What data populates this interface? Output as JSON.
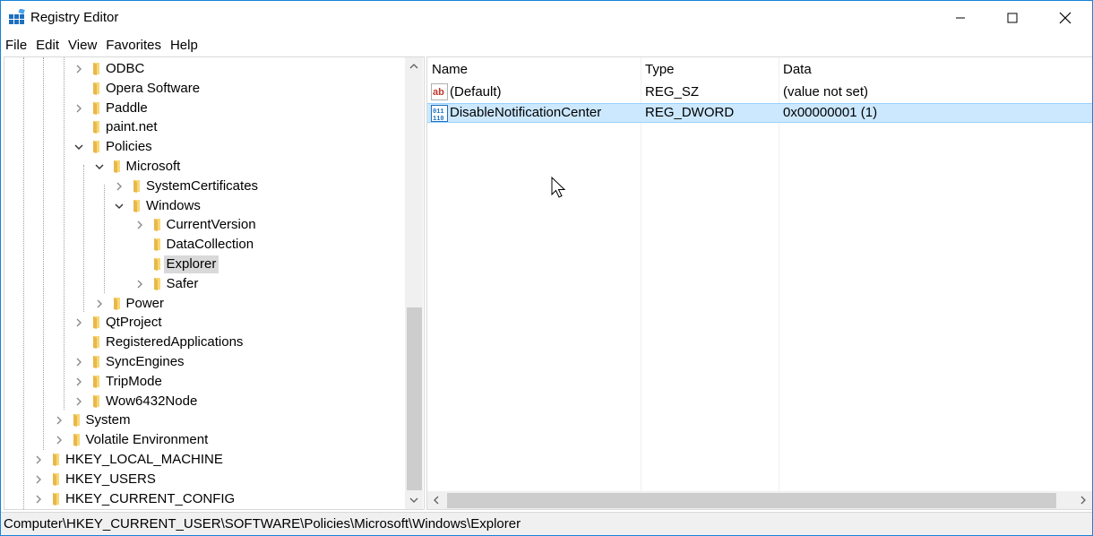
{
  "window": {
    "title": "Registry Editor"
  },
  "menu": [
    "File",
    "Edit",
    "View",
    "Favorites",
    "Help"
  ],
  "tree": [
    {
      "label": "ODBC",
      "depth": 3,
      "expander": "collapsed",
      "selected": false
    },
    {
      "label": "Opera Software",
      "depth": 3,
      "expander": "none",
      "selected": false
    },
    {
      "label": "Paddle",
      "depth": 3,
      "expander": "collapsed",
      "selected": false
    },
    {
      "label": "paint.net",
      "depth": 3,
      "expander": "none",
      "selected": false
    },
    {
      "label": "Policies",
      "depth": 3,
      "expander": "expanded",
      "selected": false
    },
    {
      "label": "Microsoft",
      "depth": 4,
      "expander": "expanded",
      "selected": false
    },
    {
      "label": "SystemCertificates",
      "depth": 5,
      "expander": "collapsed",
      "selected": false
    },
    {
      "label": "Windows",
      "depth": 5,
      "expander": "expanded",
      "selected": false
    },
    {
      "label": "CurrentVersion",
      "depth": 6,
      "expander": "collapsed",
      "selected": false
    },
    {
      "label": "DataCollection",
      "depth": 6,
      "expander": "none",
      "selected": false
    },
    {
      "label": "Explorer",
      "depth": 6,
      "expander": "none",
      "selected": true
    },
    {
      "label": "Safer",
      "depth": 6,
      "expander": "collapsed",
      "selected": false
    },
    {
      "label": "Power",
      "depth": 4,
      "expander": "collapsed",
      "selected": false
    },
    {
      "label": "QtProject",
      "depth": 3,
      "expander": "collapsed",
      "selected": false
    },
    {
      "label": "RegisteredApplications",
      "depth": 3,
      "expander": "none",
      "selected": false
    },
    {
      "label": "SyncEngines",
      "depth": 3,
      "expander": "collapsed",
      "selected": false
    },
    {
      "label": "TripMode",
      "depth": 3,
      "expander": "collapsed",
      "selected": false
    },
    {
      "label": "Wow6432Node",
      "depth": 3,
      "expander": "collapsed",
      "selected": false
    },
    {
      "label": "System",
      "depth": 2,
      "expander": "collapsed",
      "selected": false
    },
    {
      "label": "Volatile Environment",
      "depth": 2,
      "expander": "collapsed",
      "selected": false
    },
    {
      "label": "HKEY_LOCAL_MACHINE",
      "depth": 1,
      "expander": "collapsed",
      "selected": false
    },
    {
      "label": "HKEY_USERS",
      "depth": 1,
      "expander": "collapsed",
      "selected": false
    },
    {
      "label": "HKEY_CURRENT_CONFIG",
      "depth": 1,
      "expander": "collapsed",
      "selected": false
    }
  ],
  "list": {
    "columns": [
      "Name",
      "Type",
      "Data"
    ],
    "rows": [
      {
        "icon": "string-value-icon",
        "name": "(Default)",
        "type": "REG_SZ",
        "data": "(value not set)",
        "selected": false
      },
      {
        "icon": "binary-value-icon",
        "name": "DisableNotificationCenter",
        "type": "REG_DWORD",
        "data": "0x00000001 (1)",
        "selected": true
      }
    ]
  },
  "status": {
    "path": "Computer\\HKEY_CURRENT_USER\\SOFTWARE\\Policies\\Microsoft\\Windows\\Explorer"
  },
  "colors": {
    "accent": "#1883d7",
    "selection": "#cce8ff",
    "folder": "#f8d775",
    "tree_selection": "#d9d9d9"
  }
}
